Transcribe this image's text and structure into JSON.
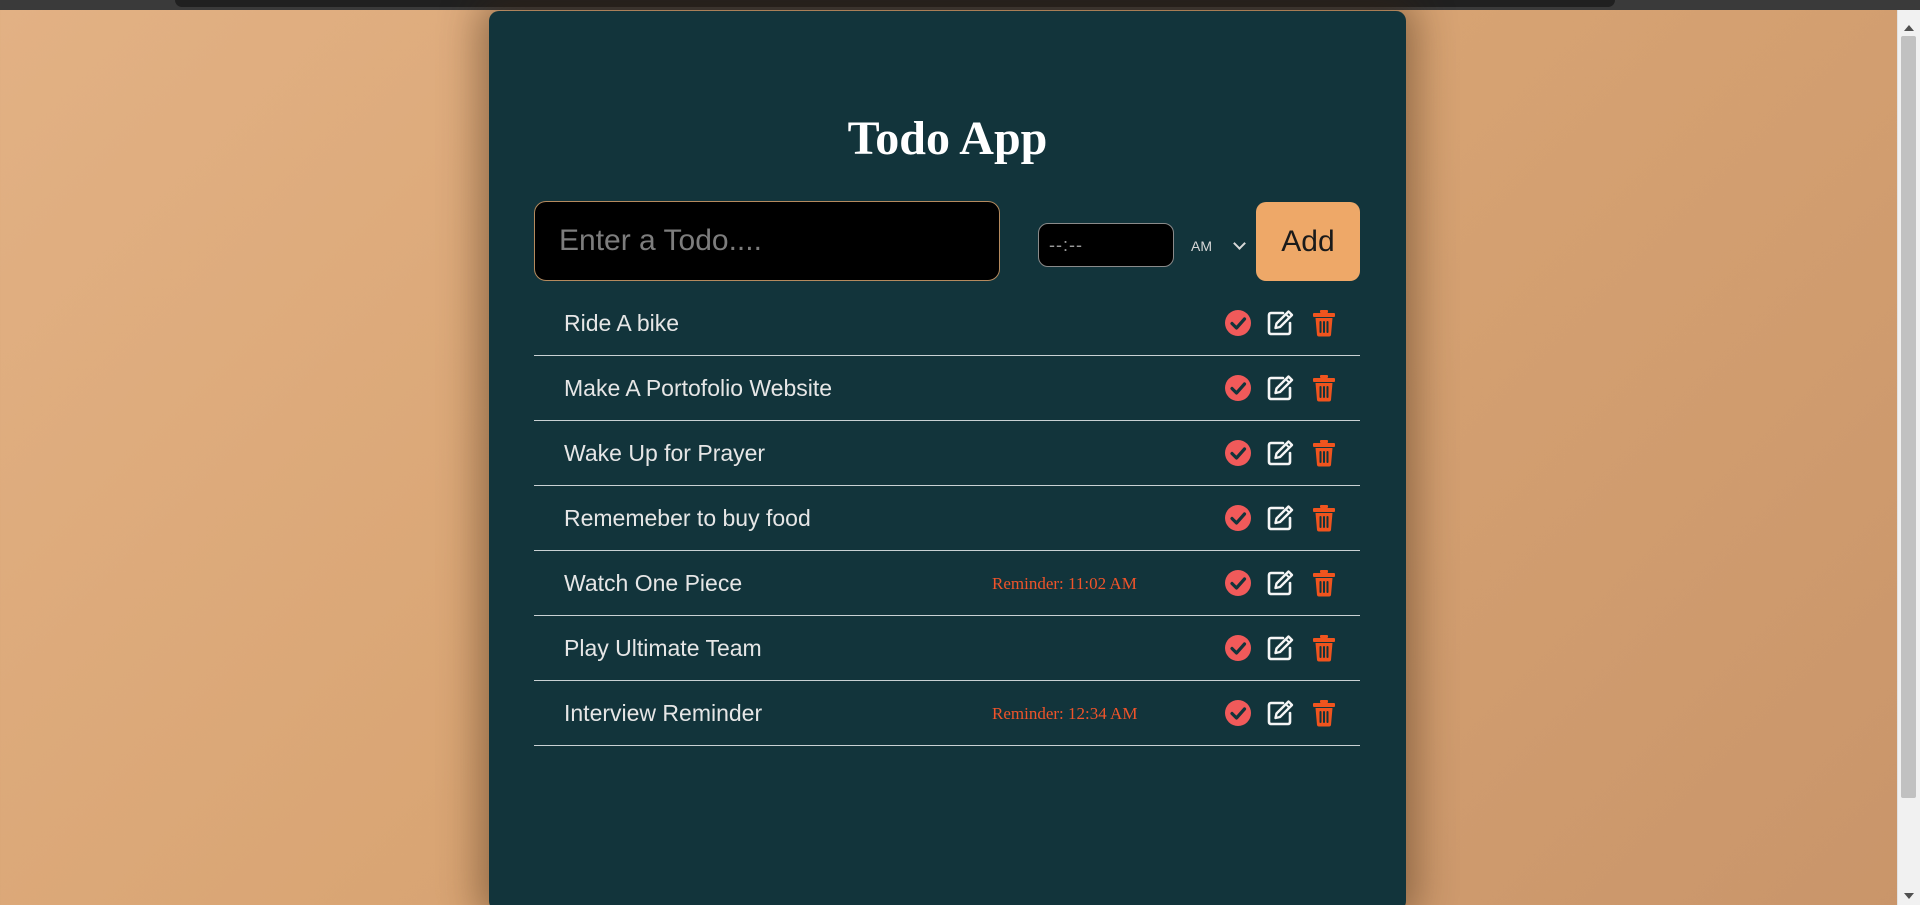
{
  "app": {
    "title": "Todo App"
  },
  "form": {
    "todo_placeholder": "Enter a Todo....",
    "time_placeholder": "--:--",
    "ampm_selected": "AM",
    "add_label": "Add"
  },
  "todos": [
    {
      "text": "Ride A bike",
      "reminder": ""
    },
    {
      "text": "Make A Portofolio Website",
      "reminder": ""
    },
    {
      "text": "Wake Up for Prayer",
      "reminder": ""
    },
    {
      "text": "Rememeber to buy food",
      "reminder": ""
    },
    {
      "text": "Watch One Piece",
      "reminder": "Reminder: 11:02 AM"
    },
    {
      "text": "Play Ultimate Team",
      "reminder": ""
    },
    {
      "text": "Interview Reminder",
      "reminder": "Reminder: 12:34 AM"
    }
  ],
  "icons": {
    "check": "check-circle-icon",
    "edit": "edit-icon",
    "delete": "trash-icon"
  },
  "colors": {
    "background": "#d9a574",
    "card": "#12343b",
    "accent": "#eea868",
    "check_icon": "#f15a5a",
    "edit_icon": "#f5f5f5",
    "delete_icon": "#f0541e",
    "reminder_text": "#f0542a"
  }
}
